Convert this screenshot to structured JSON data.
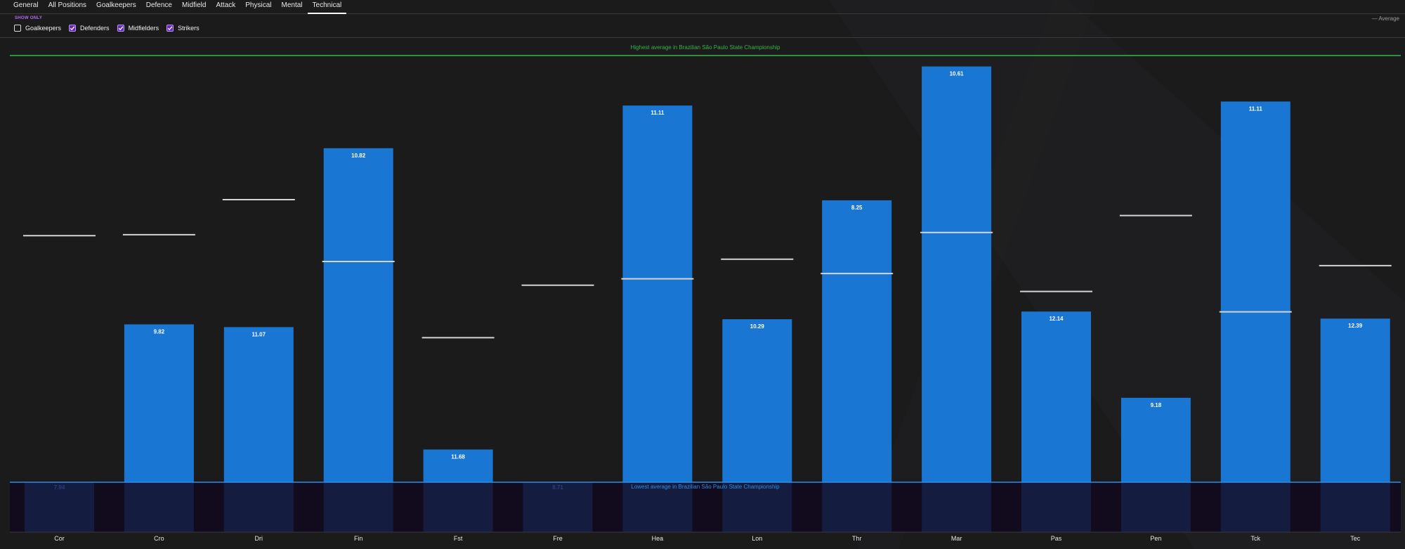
{
  "tabs": [
    {
      "label": "General",
      "active": false
    },
    {
      "label": "All Positions",
      "active": false
    },
    {
      "label": "Goalkeepers",
      "active": false
    },
    {
      "label": "Defence",
      "active": false
    },
    {
      "label": "Midfield",
      "active": false
    },
    {
      "label": "Attack",
      "active": false
    },
    {
      "label": "Physical",
      "active": false
    },
    {
      "label": "Mental",
      "active": false
    },
    {
      "label": "Technical",
      "active": true
    }
  ],
  "filters": {
    "show_only_label": "SHOW ONLY",
    "options": [
      {
        "label": "Goalkeepers",
        "checked": false
      },
      {
        "label": "Defenders",
        "checked": true
      },
      {
        "label": "Midfielders",
        "checked": true
      },
      {
        "label": "Strikers",
        "checked": true
      }
    ]
  },
  "legend": {
    "average_label": "— Average"
  },
  "colors": {
    "bar": "#1976d2",
    "bar_below": "#141c3f",
    "below_band": "#120b1e",
    "highest_line": "#37b24d",
    "lowest_line": "#2f8be6",
    "average_marker": "#d4d4d4",
    "background": "#1b1b1c"
  },
  "chart_data": {
    "type": "bar",
    "categories": [
      "Cor",
      "Cro",
      "Dri",
      "Fin",
      "Fst",
      "Fre",
      "Hea",
      "Lon",
      "Thr",
      "Mar",
      "Pas",
      "Pen",
      "Tck",
      "Tec"
    ],
    "value_labels": [
      "7.94",
      "9.82",
      "11.07",
      "10.82",
      "11.68",
      "8.71",
      "11.11",
      "10.29",
      "8.25",
      "10.61",
      "12.14",
      "9.18",
      "11.11",
      "12.39"
    ],
    "bar_level": [
      0,
      0.37,
      0.3635,
      0.7828,
      0.0767,
      0,
      0.8828,
      0.382,
      0.6607,
      0.9744,
      0.4,
      0.1979,
      0.8922,
      0.3835
    ],
    "average_level": [
      0.5778,
      0.5801,
      0.6623,
      0.5172,
      0.3387,
      0.4616,
      0.4767,
      0.5226,
      0.4891,
      0.5852,
      0.4471,
      0.6251,
      0.3992,
      0.5076
    ],
    "reference_lines": [
      {
        "label": "Highest average in Brazilian São Paulo State Championship",
        "level": 1
      },
      {
        "label": "Lowest average in Brazilian São Paulo State Championship",
        "level": 0
      }
    ],
    "legend": "Average",
    "legend_position": "top-right",
    "grid": false
  }
}
